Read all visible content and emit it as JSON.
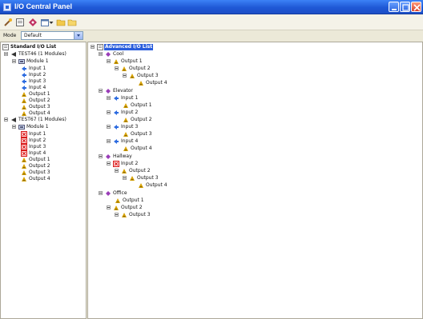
{
  "window": {
    "title": "I/O Central Panel"
  },
  "mode": {
    "label": "Mode",
    "value": "Default"
  },
  "left_tree": {
    "root_label": "Standard I/O List",
    "test46": {
      "label": "TEST46 (1 Modules)",
      "module_label": "Module 1",
      "items": [
        "Input 1",
        "Input 2",
        "Input 3",
        "Input 4",
        "Output 1",
        "Output 2",
        "Output 3",
        "Output 4"
      ]
    },
    "test67": {
      "label": "TEST67 (1 Modules)",
      "module_label": "Module 1",
      "items": [
        "Input 1",
        "Input 2",
        "Input 3",
        "Input 4",
        "Output 1",
        "Output 2",
        "Output 3",
        "Output 4"
      ]
    }
  },
  "right_tree": {
    "root_label": "Advanced I/O List",
    "cool": {
      "label": "Cool",
      "items": [
        "Output 1",
        "Output 2",
        "Output 3",
        "Output 4"
      ]
    },
    "elevator": {
      "label": "Elevator",
      "items": [
        "Input 1",
        "Output 1",
        "Input 2",
        "Output 2",
        "Input 3",
        "Output 3",
        "Input 4",
        "Output 4"
      ]
    },
    "hallway": {
      "label": "Hallway",
      "items": [
        "Input 2",
        "Output 2",
        "Output 3",
        "Output 4"
      ]
    },
    "office": {
      "label": "Office",
      "items": [
        "Output 1",
        "Output 2",
        "Output 3"
      ]
    }
  },
  "colors": {
    "title_bar": "#2459d8",
    "selection": "#2a5ddc",
    "input_icon": "#2c6be0",
    "output_icon": "#d9a300",
    "led_icon": "#d81818"
  }
}
